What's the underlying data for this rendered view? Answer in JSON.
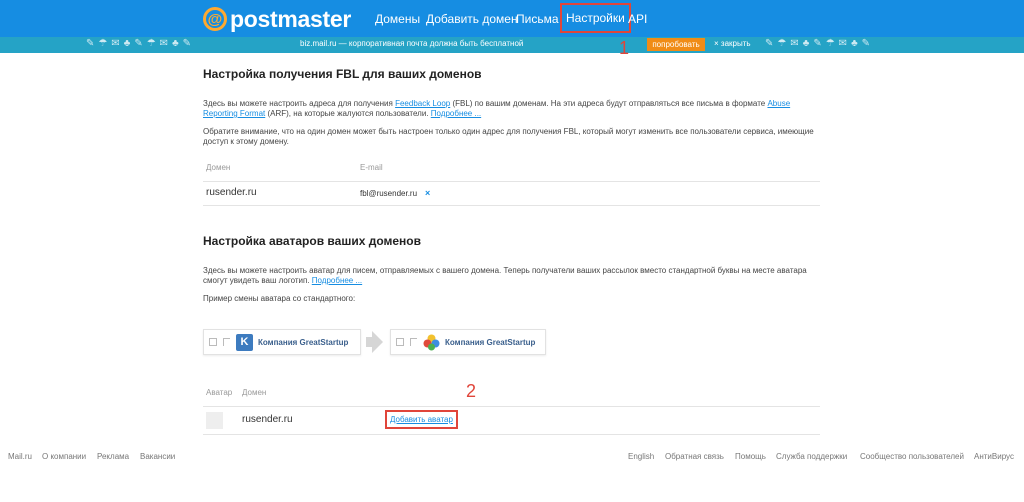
{
  "header": {
    "logo_symbol": "@",
    "logo_text": "postmaster",
    "nav": [
      "Домены",
      "Добавить домен",
      "Письма",
      "Настройки",
      "API"
    ],
    "active_nav": "Настройки"
  },
  "promo": {
    "text": "biz.mail.ru — корпоративная почта должна быть бесплатной",
    "try_label": "попробовать",
    "close_label": "× закрыть"
  },
  "markers": {
    "first": "1",
    "second": "2"
  },
  "fbl": {
    "title": "Настройка получения FBL для ваших доменов",
    "p1_a": "Здесь вы можете настроить адреса для получения ",
    "p1_link1": "Feedback Loop",
    "p1_b": " (FBL) по вашим доменам. На эти адреса будут отправляться все письма в формате ",
    "p1_link2": "Abuse Reporting Format",
    "p1_c": " (ARF), на которые жалуются пользователи. ",
    "p1_more": "Подробнее ...",
    "p2": "Обратите внимание, что на один домен может быть настроен только один адрес для получения FBL, который могут изменить все пользователи сервиса, имеющие доступ к этому домену.",
    "col_domain": "Домен",
    "col_email": "E-mail",
    "row_domain": "rusender.ru",
    "row_email": "fbl@rusender.ru",
    "remove": "×"
  },
  "avatars": {
    "title": "Настройка аватаров ваших доменов",
    "p1": "Здесь вы можете настроить аватар для писем, отправляемых с вашего домена. Теперь получатели ваших рассылок вместо стандартной буквы на месте аватара смогут увидеть ваш логотип. ",
    "p1_more": "Подробнее ...",
    "p2": "Пример смены аватара со стандартного:",
    "example_letter": "K",
    "example_company": "Компания GreatStartup",
    "col_avatar": "Аватар",
    "col_domain": "Домен",
    "row_domain": "rusender.ru",
    "add_avatar": "Добавить аватар"
  },
  "footer": {
    "left": [
      "Mail.ru",
      "О компании",
      "Реклама",
      "Вакансии"
    ],
    "right": [
      "English",
      "Обратная связь",
      "Помощь",
      "Служба поддержки",
      "Сообщество пользователей",
      "АнтиВирус"
    ]
  },
  "colors": {
    "header": "#168de2",
    "promo": "#25a3c6",
    "accent": "#f08c16",
    "highlight": "#e0453a"
  }
}
